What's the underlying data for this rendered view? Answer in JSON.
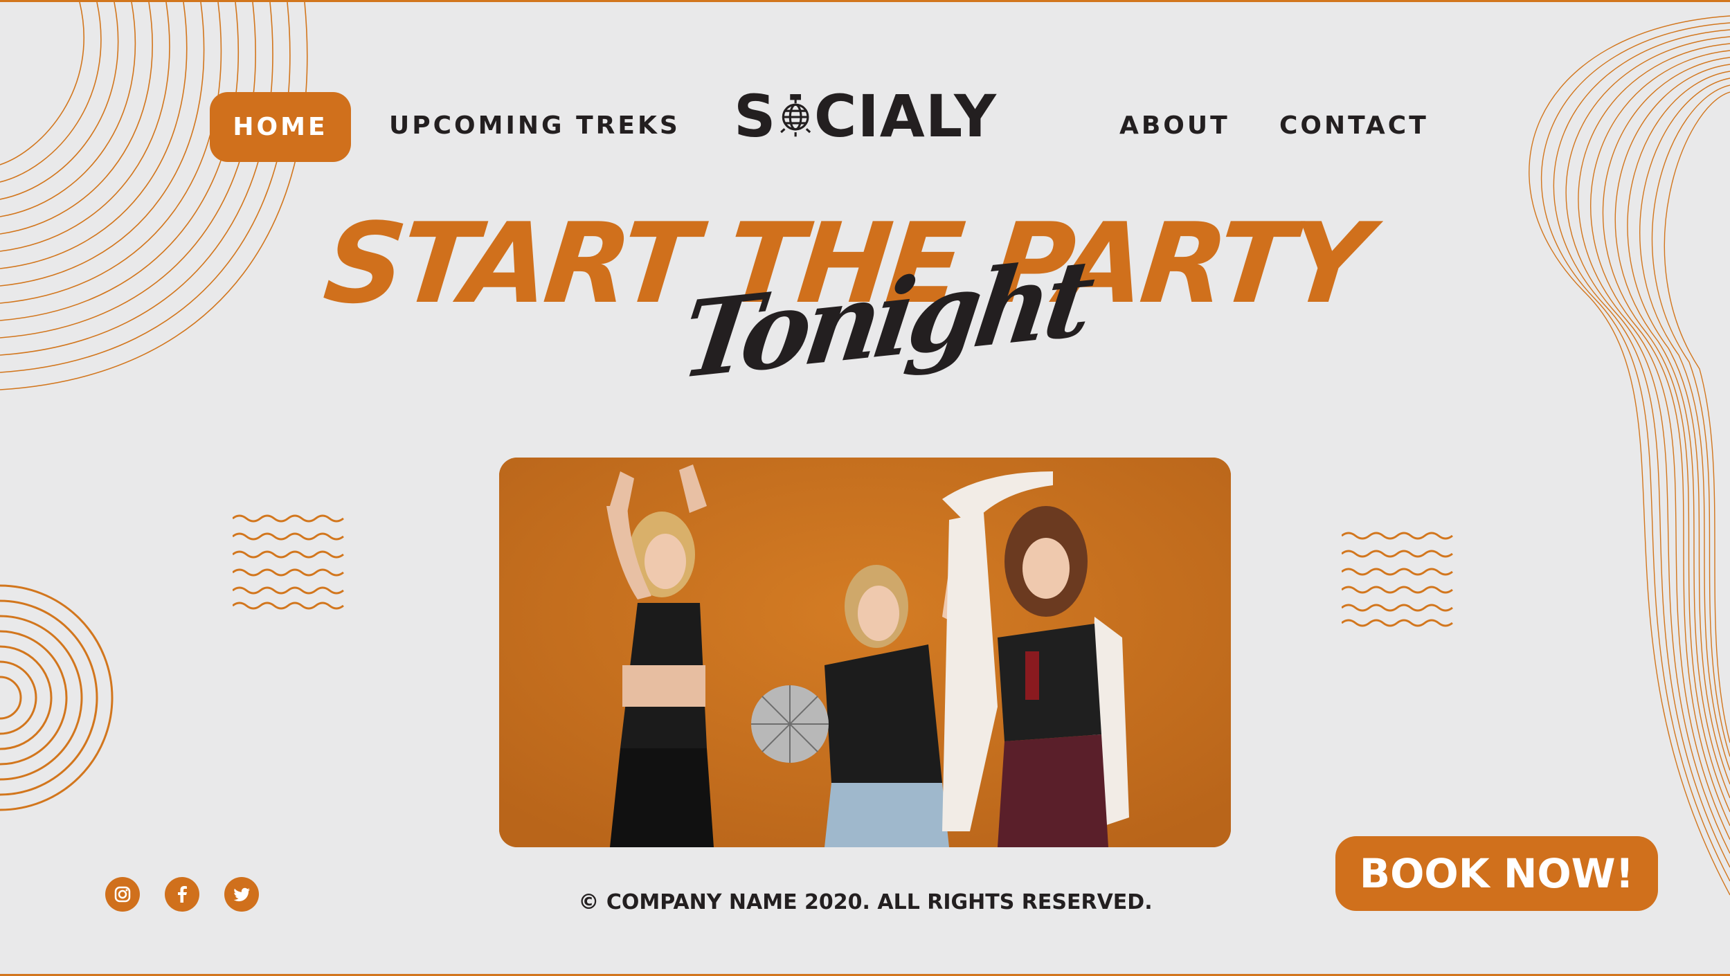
{
  "nav": {
    "home": "HOME",
    "upcoming": "UPCOMING TREKS",
    "about": "ABOUT",
    "contact": "CONTACT"
  },
  "logo": {
    "text_left": "S",
    "text_right": "CIALY"
  },
  "hero": {
    "headline": "START THE PARTY",
    "script": "Tonight"
  },
  "cta": {
    "book_label": "BOOK NOW!"
  },
  "footer": {
    "copyright": "© COMPANY NAME 2020. ALL RIGHTS RESERVED.",
    "social": [
      "instagram-icon",
      "facebook-icon",
      "twitter-icon"
    ]
  },
  "colors": {
    "accent": "#d0701c",
    "dark": "#231f20",
    "background": "#e9e9ea"
  }
}
